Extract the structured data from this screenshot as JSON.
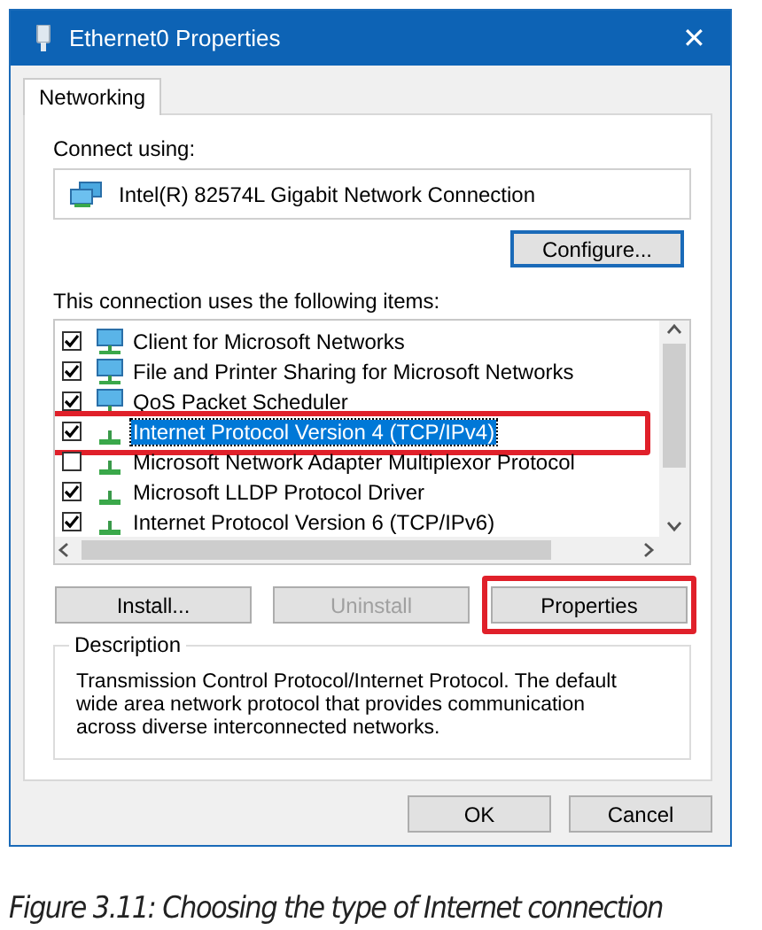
{
  "window": {
    "title": "Ethernet0 Properties",
    "close": "✕"
  },
  "tabs": [
    {
      "label": "Networking",
      "selected": true
    }
  ],
  "connect_using": {
    "label": "Connect using:",
    "adapter": "Intel(R) 82574L Gigabit Network Connection"
  },
  "configure_button": "Configure...",
  "items_label": "This connection uses the following items:",
  "items": [
    {
      "label": "Client for Microsoft Networks",
      "kind": "service",
      "checked": true,
      "selected": false,
      "annotated": false
    },
    {
      "label": "File and Printer Sharing for Microsoft Networks",
      "kind": "service",
      "checked": true,
      "selected": false,
      "annotated": false
    },
    {
      "label": "QoS Packet Scheduler",
      "kind": "service",
      "checked": true,
      "selected": false,
      "annotated": false
    },
    {
      "label": "Internet Protocol Version 4 (TCP/IPv4)",
      "kind": "protocol",
      "checked": true,
      "selected": true,
      "annotated": true
    },
    {
      "label": "Microsoft Network Adapter Multiplexor Protocol",
      "kind": "protocol",
      "checked": false,
      "selected": false,
      "annotated": false
    },
    {
      "label": "Microsoft LLDP Protocol Driver",
      "kind": "protocol",
      "checked": true,
      "selected": false,
      "annotated": false
    },
    {
      "label": "Internet Protocol Version 6 (TCP/IPv6)",
      "kind": "protocol",
      "checked": true,
      "selected": false,
      "annotated": false
    }
  ],
  "item_buttons": [
    {
      "label": "Install...",
      "disabled": false,
      "annotated": false
    },
    {
      "label": "Uninstall",
      "disabled": true,
      "annotated": false
    },
    {
      "label": "Properties",
      "disabled": false,
      "annotated": true
    }
  ],
  "description": {
    "title": "Description",
    "text": "Transmission Control Protocol/Internet Protocol. The default wide area network protocol that provides communication across diverse interconnected networks."
  },
  "dialog_buttons": [
    "OK",
    "Cancel"
  ],
  "caption": "Figure 3.11: Choosing the type of Internet connection"
}
